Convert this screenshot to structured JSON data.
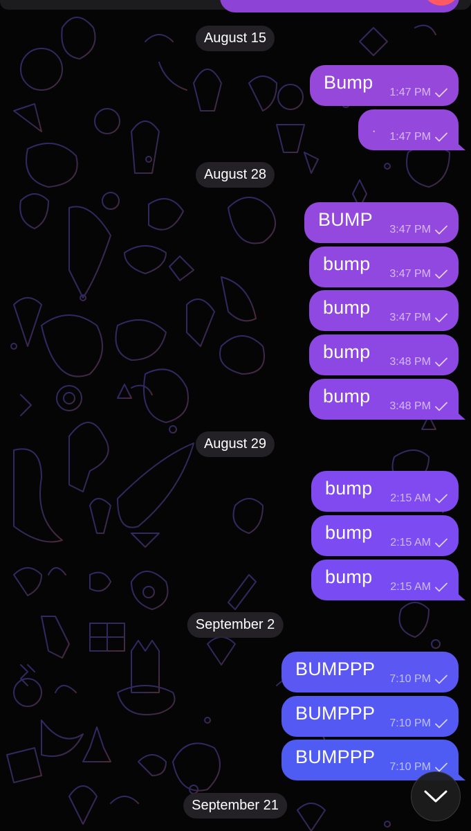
{
  "colors": {
    "background": "#050505",
    "date_pill": "#262428",
    "bubble_purple": "#9646dc",
    "bubble_violet": "#7f49ef",
    "bubble_blue": "#5459f2"
  },
  "status_icon": "single-checkmark-icon",
  "scroll_button_icon": "chevron-down-icon",
  "dates": {
    "aug15": "August 15",
    "aug28": "August 28",
    "aug29": "August 29",
    "sep2": "September 2",
    "sep21": "September 21"
  },
  "messages": [
    {
      "text": "Bump",
      "time": "1:47 PM"
    },
    {
      "text": "·",
      "time": "1:47 PM"
    },
    {
      "text": "BUMP",
      "time": "3:47 PM"
    },
    {
      "text": "bump",
      "time": "3:47 PM"
    },
    {
      "text": "bump",
      "time": "3:47 PM"
    },
    {
      "text": "bump",
      "time": "3:48 PM"
    },
    {
      "text": "bump",
      "time": "3:48 PM"
    },
    {
      "text": "bump",
      "time": "2:15 AM"
    },
    {
      "text": "bump",
      "time": "2:15 AM"
    },
    {
      "text": "bump",
      "time": "2:15 AM"
    },
    {
      "text": "BUMPPP",
      "time": "7:10 PM"
    },
    {
      "text": "BUMPPP",
      "time": "7:10 PM"
    },
    {
      "text": "BUMPPP",
      "time": "7:10 PM"
    }
  ]
}
